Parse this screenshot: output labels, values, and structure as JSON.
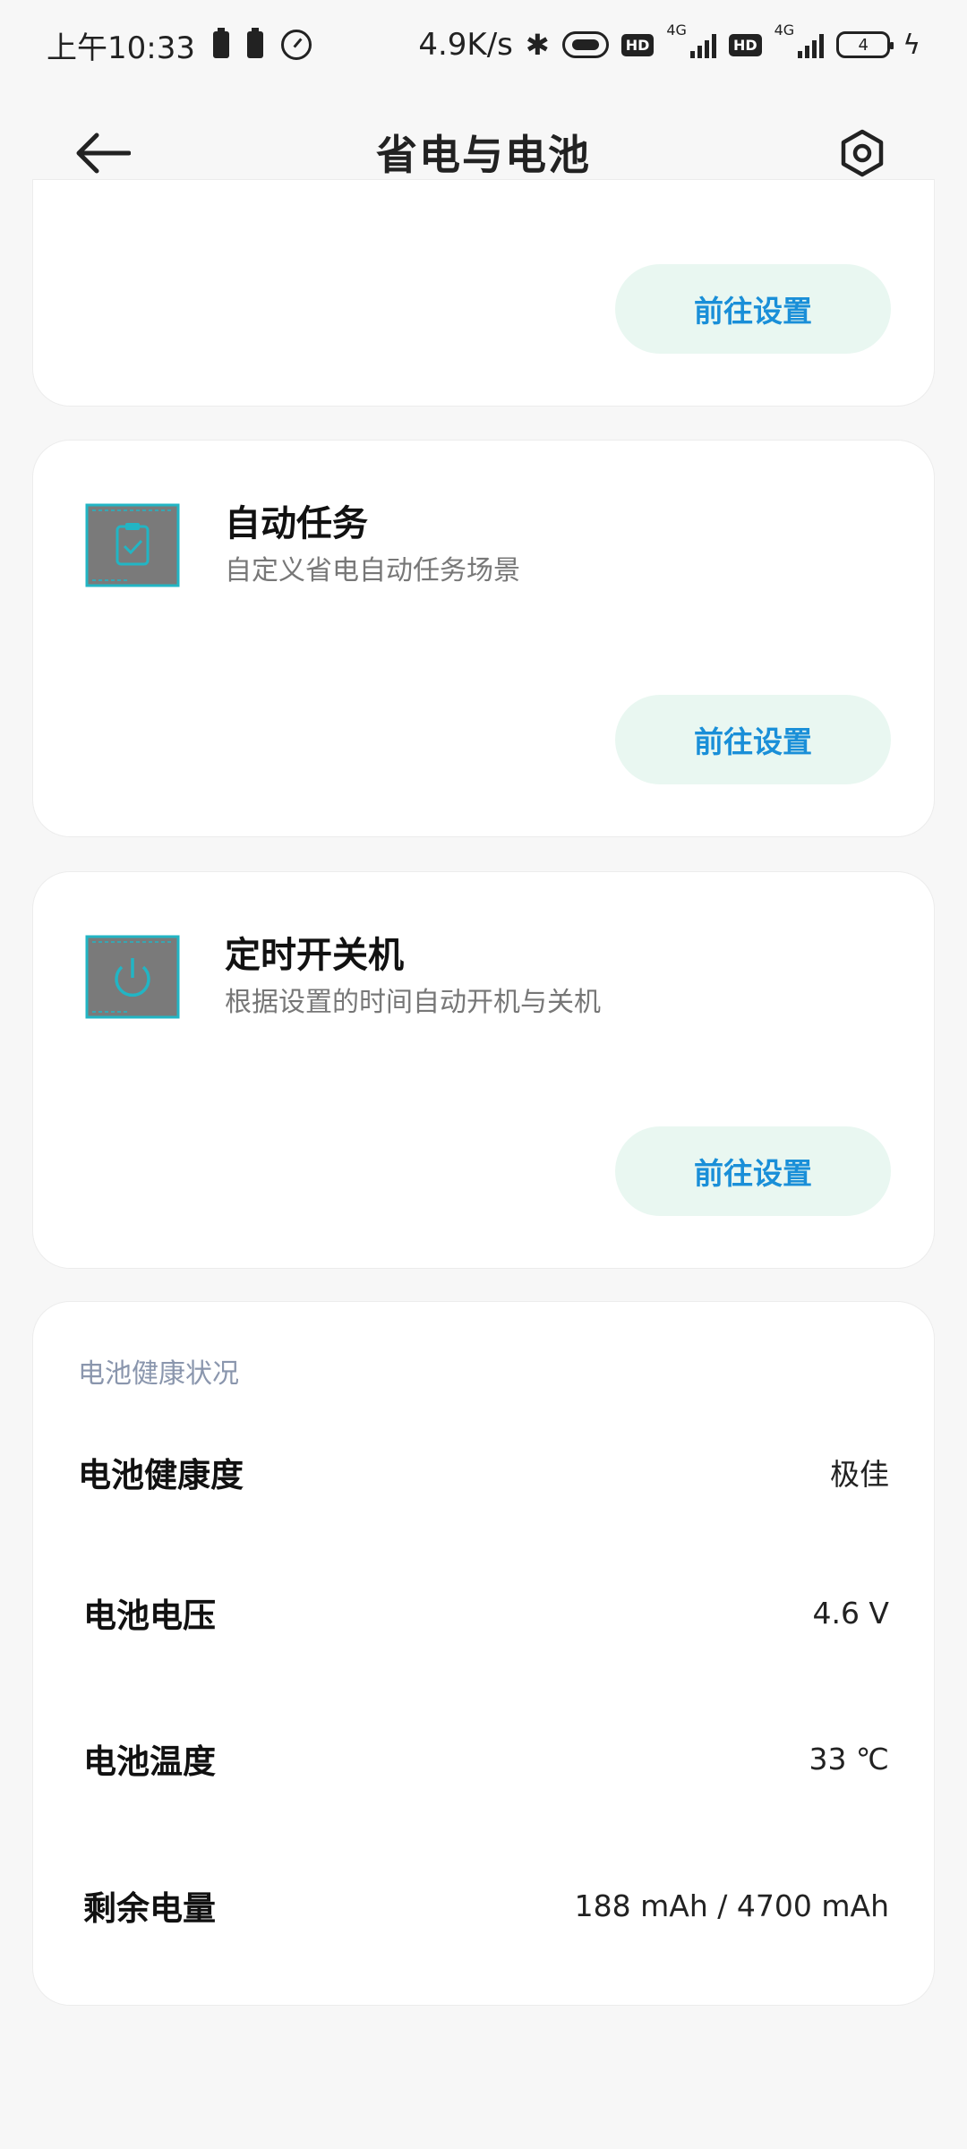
{
  "status_bar": {
    "time": "上午10:33",
    "net_speed": "4.9K/s",
    "hd_label": "HD",
    "network_type": "4G",
    "battery_level": "4"
  },
  "header": {
    "title": "省电与电池"
  },
  "cards": [
    {
      "button_label": "前往设置"
    },
    {
      "title": "自动任务",
      "description": "自定义省电自动任务场景",
      "button_label": "前往设置",
      "icon": "clipboard-check-icon"
    },
    {
      "title": "定时开关机",
      "description": "根据设置的时间自动开机与关机",
      "button_label": "前往设置",
      "icon": "power-icon"
    }
  ],
  "battery_health": {
    "section_title": "电池健康状况",
    "rows": [
      {
        "label": "电池健康度",
        "value": "极佳"
      },
      {
        "label": "电池电压",
        "value": "4.6 V"
      },
      {
        "label": "电池温度",
        "value": "33 ℃"
      },
      {
        "label": "剩余电量",
        "value": "188 mAh / 4700 mAh"
      }
    ]
  },
  "colors": {
    "accent_text": "#1a8fd8",
    "button_bg": "#e9f7f1",
    "section_header": "#8a96ad",
    "icon_teal": "#22b5c4"
  }
}
